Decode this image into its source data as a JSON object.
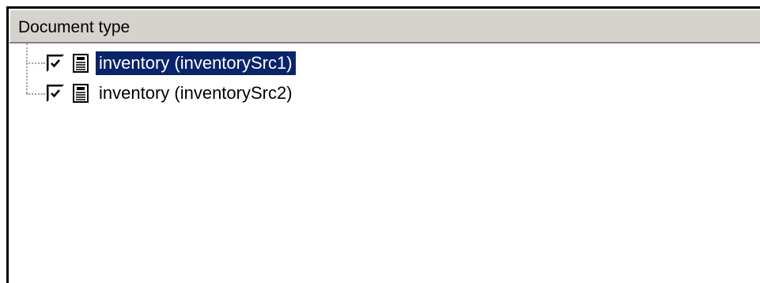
{
  "header": {
    "title": "Document type"
  },
  "tree": {
    "items": [
      {
        "label": "inventory (inventorySrc1)",
        "checked": true,
        "selected": true,
        "icon": "document-icon"
      },
      {
        "label": "inventory (inventorySrc2)",
        "checked": true,
        "selected": false,
        "icon": "document-icon"
      }
    ]
  },
  "colors": {
    "header_bg": "#d6d3ce",
    "selection_bg": "#0a246a",
    "selection_fg": "#ffffff"
  }
}
